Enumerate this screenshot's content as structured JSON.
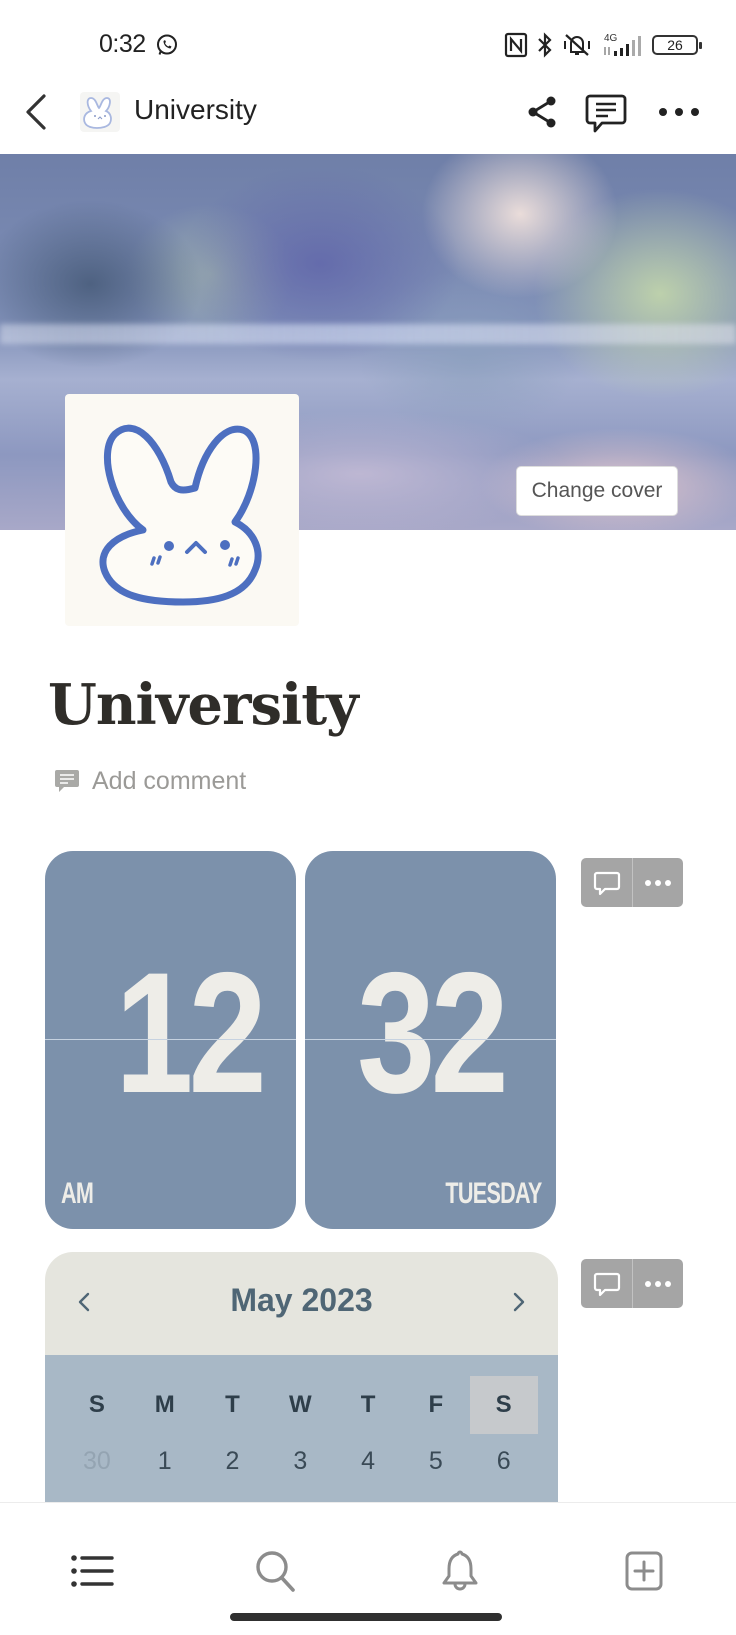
{
  "status_bar": {
    "time": "0:32",
    "notification_icons": [
      "whatsapp-icon"
    ],
    "system_icons": [
      "nfc-icon",
      "bluetooth-icon",
      "vibrate-off-icon",
      "signal-4g-icon"
    ],
    "network_label": "4G",
    "battery_level": "26"
  },
  "topbar": {
    "page_icon": "bunny-icon",
    "title": "University",
    "actions": [
      "share-icon",
      "comments-icon",
      "more-icon"
    ]
  },
  "cover": {
    "change_cover_label": "Change cover"
  },
  "page": {
    "icon": "bunny-icon",
    "title": "University",
    "add_comment_label": "Add comment"
  },
  "clock_widget": {
    "hours": "12",
    "minutes": "32",
    "meridiem": "AM",
    "weekday": "TUESDAY",
    "card_color": "#7c91ab"
  },
  "calendar_widget": {
    "month_label": "May 2023",
    "weekdays": [
      "S",
      "M",
      "T",
      "W",
      "T",
      "F",
      "S"
    ],
    "selected_weekday_index": 6,
    "first_week": [
      {
        "day": "30",
        "muted": true
      },
      {
        "day": "1",
        "muted": false
      },
      {
        "day": "2",
        "muted": false
      },
      {
        "day": "3",
        "muted": false
      },
      {
        "day": "4",
        "muted": false
      },
      {
        "day": "5",
        "muted": false
      },
      {
        "day": "6",
        "muted": false
      }
    ],
    "header_color": "#e5e5de",
    "body_color": "#a8b8c6"
  },
  "bottom_nav": {
    "items": [
      "list-icon",
      "search-icon",
      "bell-icon",
      "new-page-icon"
    ]
  }
}
